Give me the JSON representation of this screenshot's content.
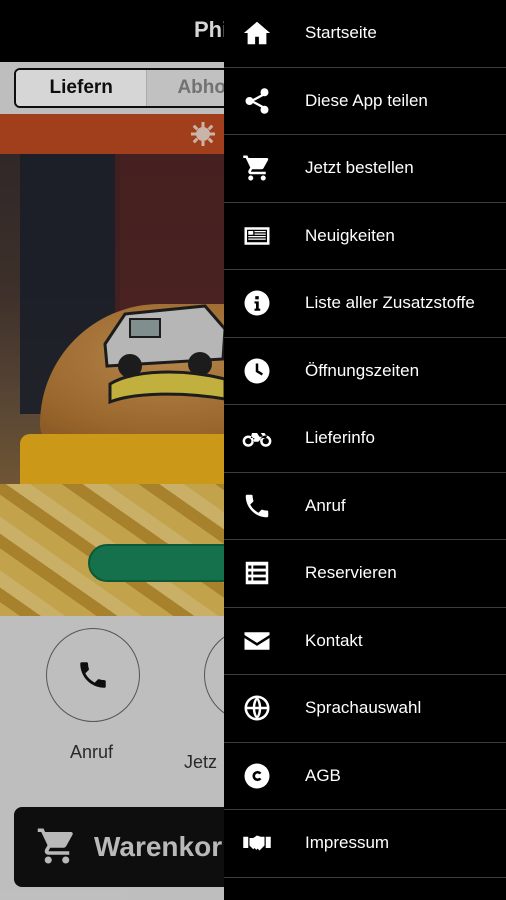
{
  "app": {
    "title": "Phi",
    "tabs": {
      "deliver": "Liefern",
      "pickup": "Abho"
    },
    "quick_actions": [
      {
        "label": "Anruf"
      },
      {
        "label": "Jetz"
      }
    ],
    "cart": {
      "label": "Warenkorb"
    },
    "colors": {
      "banner": "#c04a22",
      "hero_button": "#19875a",
      "header": "#000000"
    }
  },
  "drawer": {
    "items": [
      {
        "label": "Startseite",
        "icon": "home-icon"
      },
      {
        "label": "Diese App teilen",
        "icon": "share-icon"
      },
      {
        "label": "Jetzt bestellen",
        "icon": "cart-icon"
      },
      {
        "label": "Neuigkeiten",
        "icon": "news-icon"
      },
      {
        "label": "Liste aller Zusatzstoffe",
        "icon": "info-icon"
      },
      {
        "label": "Öffnungszeiten",
        "icon": "clock-icon"
      },
      {
        "label": "Lieferinfo",
        "icon": "motorcycle-icon"
      },
      {
        "label": "Anruf",
        "icon": "phone-icon"
      },
      {
        "label": "Reservieren",
        "icon": "list-icon"
      },
      {
        "label": "Kontakt",
        "icon": "envelope-icon"
      },
      {
        "label": "Sprachauswahl",
        "icon": "globe-icon"
      },
      {
        "label": "AGB",
        "icon": "copyright-icon"
      },
      {
        "label": "Impressum",
        "icon": "handshake-icon"
      }
    ]
  }
}
